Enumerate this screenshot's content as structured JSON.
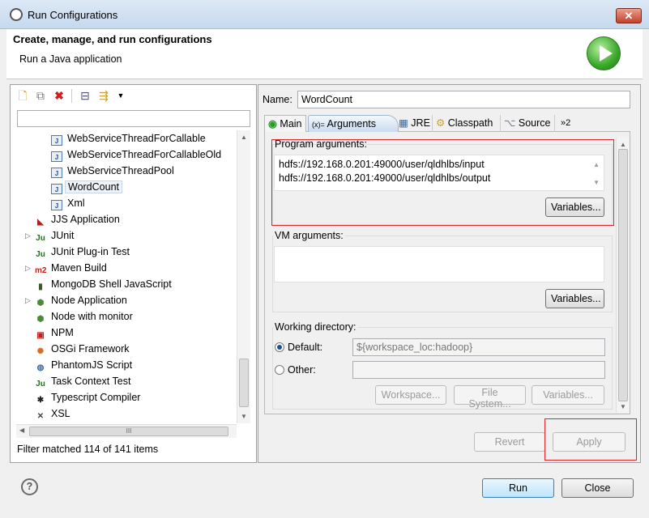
{
  "window": {
    "title": "Run Configurations",
    "close": "✕"
  },
  "header": {
    "title": "Create, manage, and run configurations",
    "subtitle": "Run a Java application"
  },
  "left": {
    "filter_value": "",
    "items": [
      {
        "label": "WebServiceThreadForCallable",
        "icon": "java-app-icon",
        "level": 1
      },
      {
        "label": "WebServiceThreadForCallableOld",
        "icon": "java-app-icon",
        "level": 1
      },
      {
        "label": "WebServiceThreadPool",
        "icon": "java-app-icon",
        "level": 1
      },
      {
        "label": "WordCount",
        "icon": "java-app-icon",
        "level": 1,
        "selected": true
      },
      {
        "label": "Xml",
        "icon": "java-app-icon",
        "level": 1
      },
      {
        "label": "JJS Application",
        "icon": "jjs-icon",
        "level": 0
      },
      {
        "label": "JUnit",
        "icon": "junit-icon",
        "level": 0,
        "expandable": true
      },
      {
        "label": "JUnit Plug-in Test",
        "icon": "junit-plugin-icon",
        "level": 0
      },
      {
        "label": "Maven Build",
        "icon": "maven-icon",
        "level": 0,
        "expandable": true
      },
      {
        "label": "MongoDB Shell JavaScript",
        "icon": "mongodb-icon",
        "level": 0
      },
      {
        "label": "Node Application",
        "icon": "node-icon",
        "level": 0,
        "expandable": true
      },
      {
        "label": "Node with monitor",
        "icon": "node-monitor-icon",
        "level": 0
      },
      {
        "label": "NPM",
        "icon": "npm-icon",
        "level": 0
      },
      {
        "label": "OSGi Framework",
        "icon": "osgi-icon",
        "level": 0
      },
      {
        "label": "PhantomJS Script",
        "icon": "phantomjs-icon",
        "level": 0
      },
      {
        "label": "Task Context Test",
        "icon": "task-context-icon",
        "level": 0
      },
      {
        "label": "Typescript Compiler",
        "icon": "typescript-icon",
        "level": 0
      },
      {
        "label": "XSL",
        "icon": "xsl-icon",
        "level": 0
      }
    ],
    "status": "Filter matched 114 of 141 items",
    "hscroll_label": "III"
  },
  "right": {
    "name_label": "Name:",
    "name_value": "WordCount",
    "tabs": [
      {
        "label": "Main"
      },
      {
        "label": "Arguments",
        "active": true
      },
      {
        "label": "JRE"
      },
      {
        "label": "Classpath"
      },
      {
        "label": "Source"
      },
      {
        "label": "»2"
      }
    ],
    "program_args_label": "Program arguments:",
    "program_args": [
      "hdfs://192.168.0.201:49000/user/qldhlbs/input",
      "hdfs://192.168.0.201:49000/user/qldhlbs/output"
    ],
    "variables": "Variables...",
    "vm_args_label": "VM arguments:",
    "vm_args": "",
    "workdir_label": "Working directory:",
    "default_label": "Default:",
    "default_value": "${workspace_loc:hadoop}",
    "other_label": "Other:",
    "other_value": "",
    "workspace_btn": "Workspace...",
    "filesystem_btn": "File System...",
    "revert": "Revert",
    "apply": "Apply"
  },
  "footer": {
    "run": "Run",
    "close": "Close",
    "help": "?"
  },
  "colors": {
    "highlight": "#e0262c",
    "accent": "#3aa82a"
  }
}
